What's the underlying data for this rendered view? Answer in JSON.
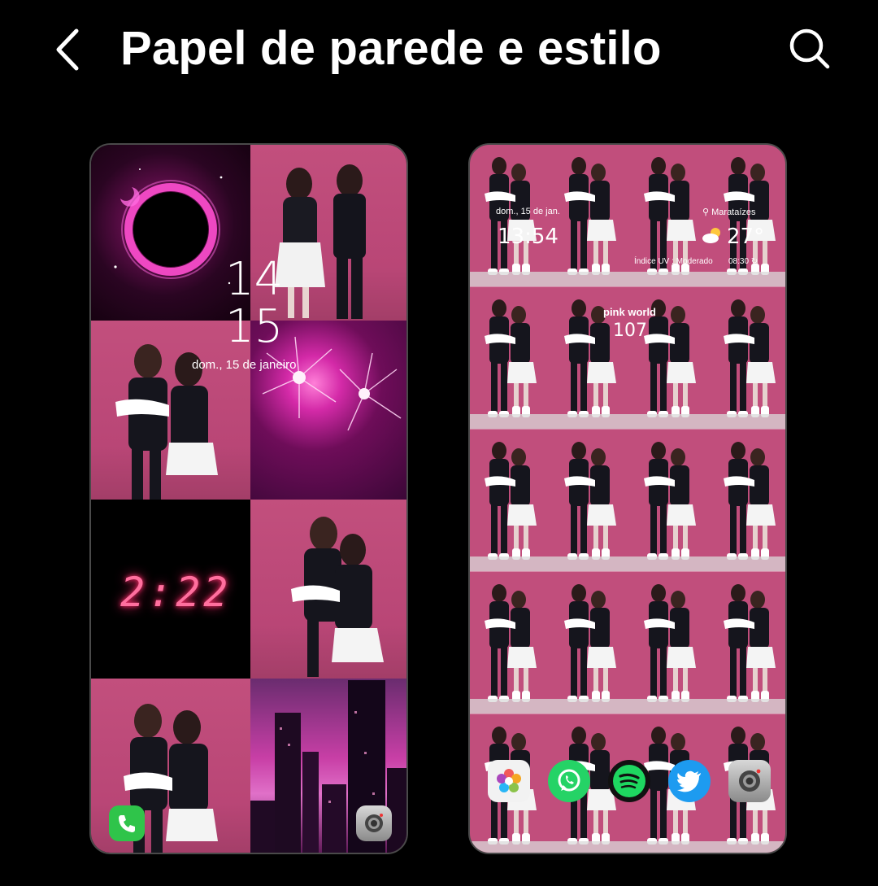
{
  "header": {
    "title": "Papel de parede e estilo",
    "back_icon": "chevron-left-icon",
    "search_icon": "search-icon"
  },
  "lock_screen": {
    "clock_hour": "14",
    "clock_minute": "15",
    "date": "dom., 15 de janeiro",
    "digital_clock": "2:22",
    "shortcuts": [
      "phone-icon",
      "camera-icon"
    ]
  },
  "home_screen": {
    "date": "dom., 15 de jan.",
    "time": "13:54",
    "location": "Marataízes",
    "temperature": "27°",
    "uv": "Índice UV : Moderado",
    "update_time": "08:30",
    "widget_title": "pink world",
    "widget_value": "107",
    "dock_apps": [
      "photos-icon",
      "whatsapp-icon",
      "spotify-icon",
      "twitter-icon",
      "camera-icon"
    ]
  },
  "colors": {
    "background": "#000000",
    "pink_wall": "#c14e7c",
    "neon_pink": "#ff6f9e"
  }
}
